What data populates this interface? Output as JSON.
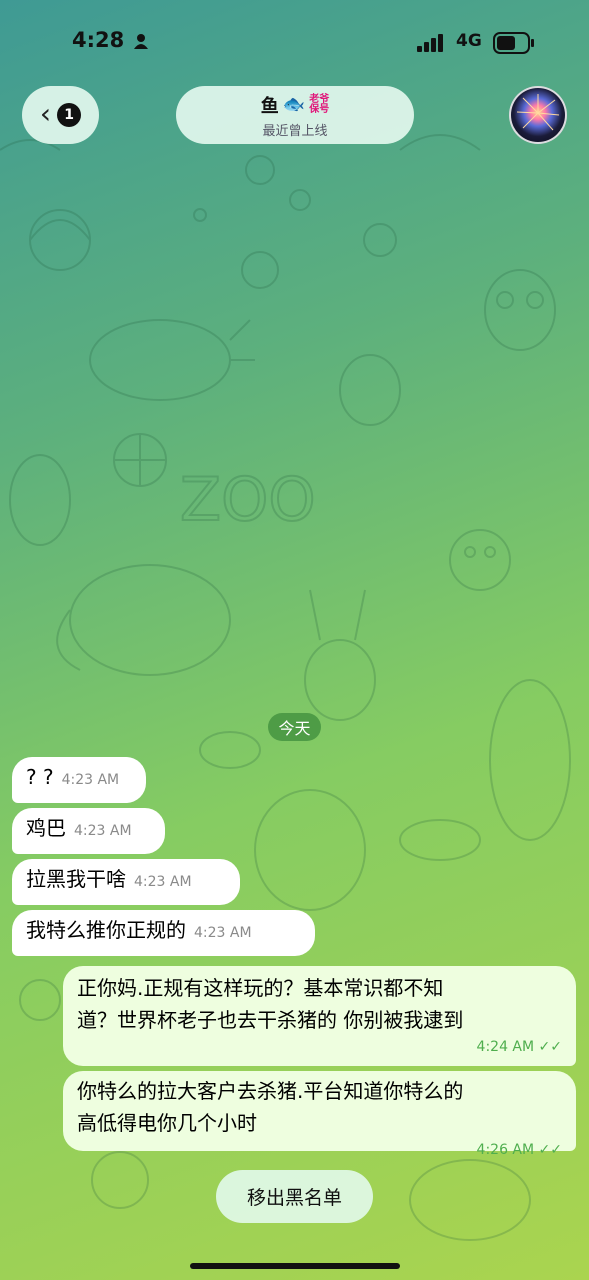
{
  "status_bar": {
    "time": "4:28",
    "network": "4G"
  },
  "header": {
    "unread_count": "1",
    "contact_name": "鱼",
    "name_emoji": "🐟",
    "tag_line1": "老爷",
    "tag_line2": "保号",
    "last_seen": "最近曾上线"
  },
  "date_chip": "今天",
  "messages": [
    {
      "direction": "in",
      "text": "? ?",
      "time": "4:23 AM"
    },
    {
      "direction": "in",
      "text": "鸡巴",
      "time": "4:23 AM"
    },
    {
      "direction": "in",
      "text": "拉黑我干啥",
      "time": "4:23 AM"
    },
    {
      "direction": "in",
      "text": "我特么推你正规的",
      "time": "4:23 AM"
    },
    {
      "direction": "out",
      "text_line1": "正你妈.正规有这样玩的？基本常识都不知",
      "text_line2": "道？世界杯老子也去干杀猪的 你别被我逮到",
      "time": "4:24 AM ✓✓"
    },
    {
      "direction": "out",
      "text_line1": "你特么的拉大客户去杀猪.平台知道你特么的",
      "text_line2": "高低得电你几个小时",
      "time": "4:26 AM ✓✓"
    }
  ],
  "bottom_action": {
    "label": "移出黑名单"
  },
  "colors": {
    "incoming_bubble": "#ffffff",
    "outgoing_bubble": "#eefedf",
    "read_tick": "#4fae4e",
    "date_chip": "#4e9c46"
  }
}
